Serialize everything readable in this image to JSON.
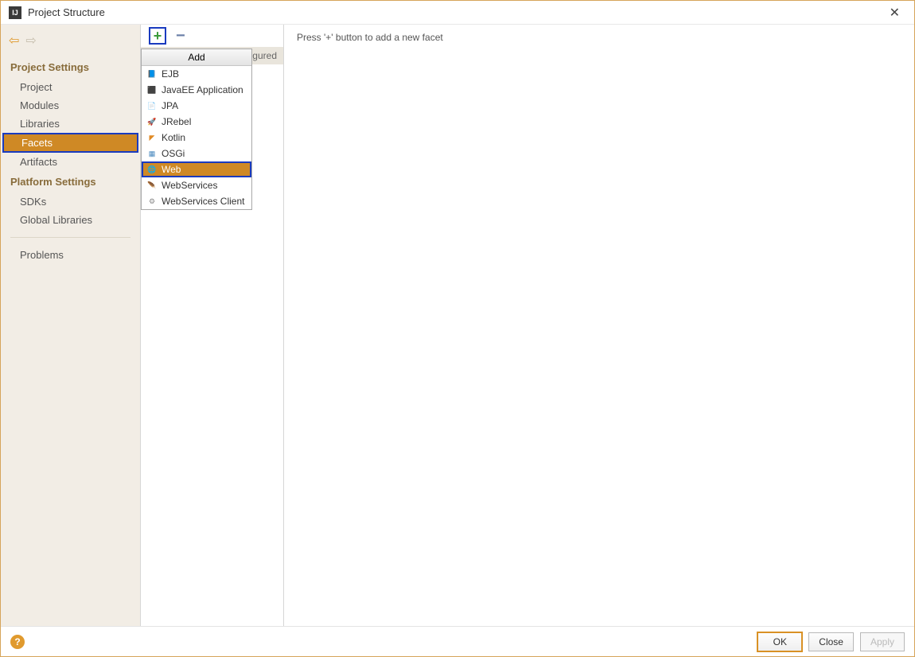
{
  "window": {
    "title": "Project Structure"
  },
  "sidebar": {
    "headers": {
      "project": "Project Settings",
      "platform": "Platform Settings"
    },
    "items": {
      "project": "Project",
      "modules": "Modules",
      "libraries": "Libraries",
      "facets": "Facets",
      "artifacts": "Artifacts",
      "sdks": "SDKs",
      "global_libraries": "Global Libraries",
      "problems": "Problems"
    }
  },
  "toolbar": {
    "config_suffix": "igured"
  },
  "dropdown": {
    "title": "Add",
    "items": [
      {
        "label": "EJB",
        "icon": "📘",
        "color": "#d38a2a"
      },
      {
        "label": "JavaEE Application",
        "icon": "⬛",
        "color": "#5c7eb0"
      },
      {
        "label": "JPA",
        "icon": "📄",
        "color": "#5c7eb0"
      },
      {
        "label": "JRebel",
        "icon": "🚀",
        "color": "#3a9b3a"
      },
      {
        "label": "Kotlin",
        "icon": "◤",
        "color": "#e08a24"
      },
      {
        "label": "OSGi",
        "icon": "▦",
        "color": "#4a8abf"
      },
      {
        "label": "Web",
        "icon": "🌐",
        "color": "#4aa0cf",
        "selected": true
      },
      {
        "label": "WebServices",
        "icon": "🪶",
        "color": "#d4a654"
      },
      {
        "label": "WebServices Client",
        "icon": "⚙",
        "color": "#888"
      }
    ]
  },
  "content": {
    "hint": "Press '+' button to add a new facet"
  },
  "footer": {
    "ok": "OK",
    "close": "Close",
    "apply": "Apply"
  }
}
